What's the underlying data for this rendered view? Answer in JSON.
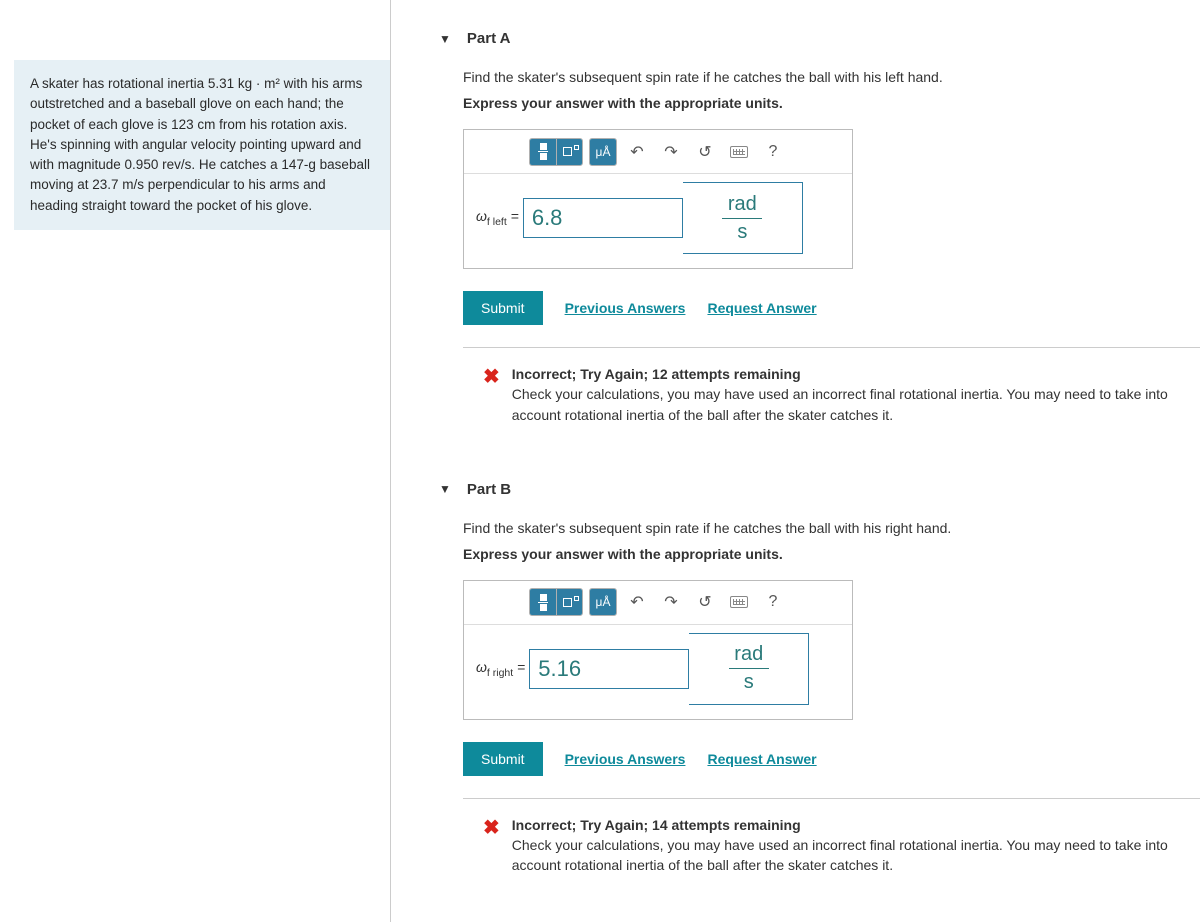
{
  "problem": "A skater has rotational inertia 5.31 kg · m² with his arms outstretched and a baseball glove on each hand; the pocket of each glove is 123 cm from his rotation axis. He's spinning with angular velocity pointing upward and with magnitude 0.950 rev/s. He catches a 147-g baseball moving at 23.7 m/s perpendicular to his arms and heading straight toward the pocket of his glove.",
  "parts": {
    "a": {
      "label": "Part A",
      "instruction": "Find the skater's subsequent spin rate if he catches the ball with his left hand.",
      "sub_instruction": "Express your answer with the appropriate units.",
      "var_prefix": "ω",
      "var_sub": "f left",
      "equals": " = ",
      "value": "6.8",
      "unit_top": "rad",
      "unit_bot": "s",
      "submit": "Submit",
      "prev": "Previous Answers",
      "req": "Request Answer",
      "fb_title": "Incorrect; Try Again; 12 attempts remaining",
      "fb_body": "Check your calculations, you may have used an incorrect final rotational inertia. You may need to take into account rotational inertia of the ball after the skater catches it."
    },
    "b": {
      "label": "Part B",
      "instruction": "Find the skater's subsequent spin rate if he catches the ball with his right hand.",
      "sub_instruction": "Express your answer with the appropriate units.",
      "var_prefix": "ω",
      "var_sub": "f right",
      "equals": " = ",
      "value": "5.16",
      "unit_top": "rad",
      "unit_bot": "s",
      "submit": "Submit",
      "prev": "Previous Answers",
      "req": "Request Answer",
      "fb_title": "Incorrect; Try Again; 14 attempts remaining",
      "fb_body": "Check your calculations, you may have used an incorrect final rotational inertia. You may need to take into account rotational inertia of the ball after the skater catches it."
    }
  },
  "toolbar": {
    "units_label": "μÅ",
    "help": "?"
  }
}
